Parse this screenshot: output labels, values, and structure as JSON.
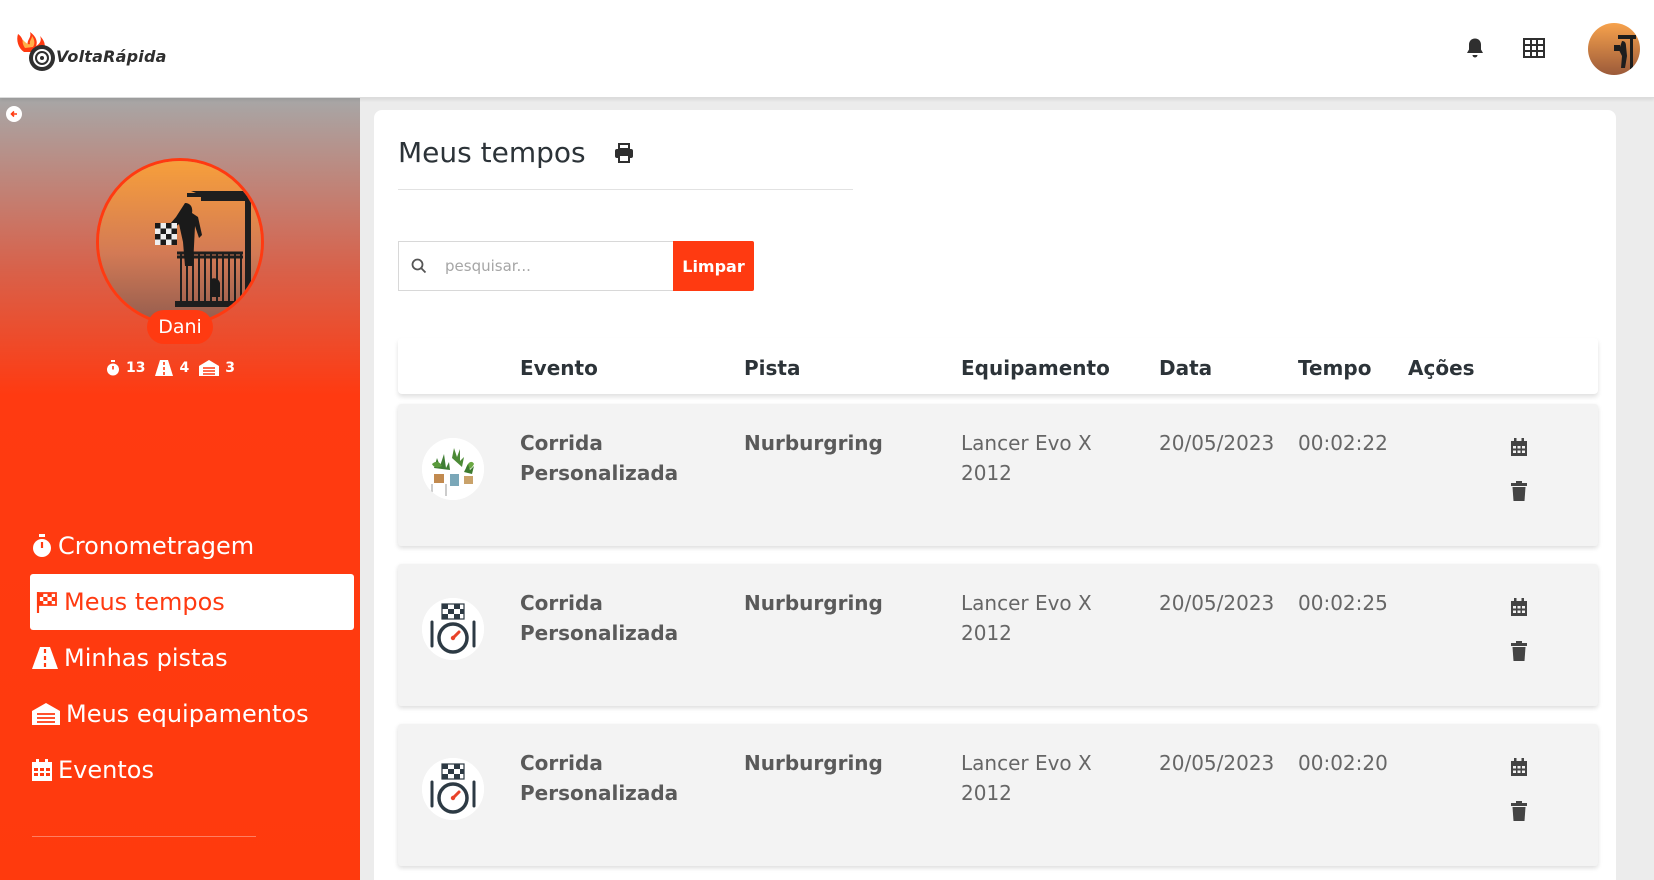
{
  "brand": {
    "name": "VoltaRápida",
    "accent": "#ff3a11"
  },
  "topbar": {
    "icons": [
      "bell-icon",
      "grid-icon"
    ]
  },
  "sidebar": {
    "user_name": "Dani",
    "stats": [
      {
        "icon": "stopwatch-icon",
        "value": "13"
      },
      {
        "icon": "road-icon",
        "value": "4"
      },
      {
        "icon": "garage-icon",
        "value": "3"
      }
    ],
    "items": [
      {
        "label": "Cronometragem",
        "icon": "stopwatch-icon"
      },
      {
        "label": "Meus tempos",
        "icon": "checkered-flag-icon",
        "active": true
      },
      {
        "label": "Minhas pistas",
        "icon": "road-icon"
      },
      {
        "label": "Meus equipamentos",
        "icon": "garage-icon"
      },
      {
        "label": "Eventos",
        "icon": "calendar-icon"
      }
    ]
  },
  "main": {
    "title": "Meus tempos",
    "search": {
      "placeholder": "pesquisar...",
      "value": ""
    },
    "clear_label": "Limpar",
    "columns": [
      "Evento",
      "Pista",
      "Equipamento",
      "Data",
      "Tempo",
      "Ações"
    ],
    "rows": [
      {
        "thumb": "plants-image",
        "evento": "Corrida Personalizada",
        "pista": "Nurburgring",
        "equipamento": "Lancer Evo X 2012",
        "data": "20/05/2023",
        "tempo": "00:02:22"
      },
      {
        "thumb": "stopwatch-flag-icon",
        "evento": "Corrida Personalizada",
        "pista": "Nurburgring",
        "equipamento": "Lancer Evo X 2012",
        "data": "20/05/2023",
        "tempo": "00:02:25"
      },
      {
        "thumb": "stopwatch-flag-icon",
        "evento": "Corrida Personalizada",
        "pista": "Nurburgring",
        "equipamento": "Lancer Evo X 2012",
        "data": "20/05/2023",
        "tempo": "00:02:20"
      }
    ]
  }
}
